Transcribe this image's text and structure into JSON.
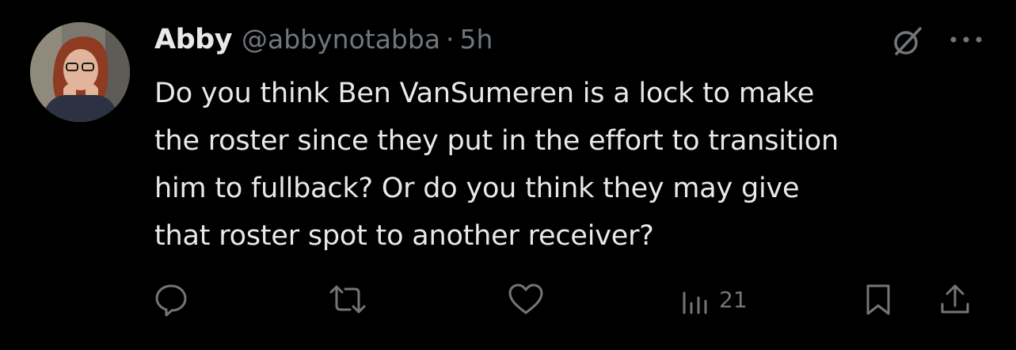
{
  "tweet": {
    "author": {
      "display_name": "Abby",
      "handle": "@abbynotabba"
    },
    "separator": "·",
    "timestamp": "5h",
    "text_lines": [
      "Do you think Ben VanSumeren is a lock to make",
      "the roster since they put in the effort to transition",
      "him to fullback? Or do you think they may give",
      "that roster spot to another receiver?"
    ],
    "actions": {
      "reply_icon": "reply-icon",
      "retweet_icon": "retweet-icon",
      "like_icon": "heart-icon",
      "views_icon": "views-chart-icon",
      "views_count": "21",
      "bookmark_icon": "bookmark-icon",
      "share_icon": "share-icon"
    }
  },
  "colors": {
    "background": "#000000",
    "primary_text": "#e7e9ea",
    "secondary_text": "#71767b"
  }
}
